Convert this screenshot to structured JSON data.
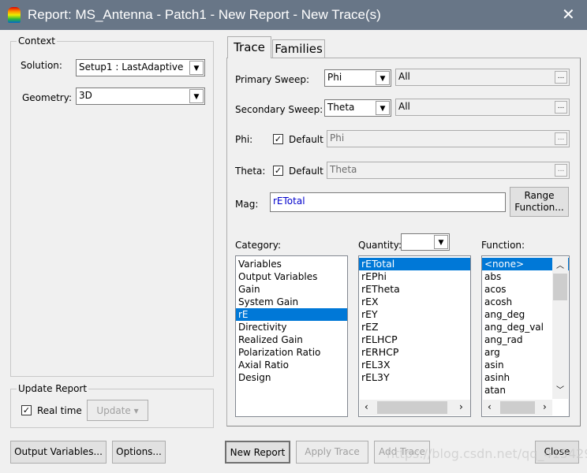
{
  "window": {
    "title": "Report: MS_Antenna - Patch1 - New Report - New Trace(s)",
    "close_glyph": "✕"
  },
  "context": {
    "legend": "Context",
    "solution_label": "Solution:",
    "solution_value": "Setup1 : LastAdaptive",
    "geometry_label": "Geometry:",
    "geometry_value": "3D"
  },
  "update": {
    "legend": "Update Report",
    "realtime_label": "Real time",
    "realtime_checked": true,
    "update_button": "Update"
  },
  "tabs": [
    {
      "label": "Trace",
      "active": true
    },
    {
      "label": "Families",
      "active": false
    }
  ],
  "trace": {
    "primary_label": "Primary Sweep:",
    "primary_value": "Phi",
    "primary_range": "All",
    "secondary_label": "Secondary Sweep:",
    "secondary_value": "Theta",
    "secondary_range": "All",
    "phi_label": "Phi:",
    "phi_default_label": "Default",
    "phi_default_checked": true,
    "phi_value": "Phi",
    "theta_label": "Theta:",
    "theta_default_label": "Default",
    "theta_default_checked": true,
    "theta_value": "Theta",
    "mag_label": "Mag:",
    "mag_value": "rETotal",
    "range_function_button": "Range Function...",
    "category_label": "Category:",
    "quantity_label": "Quantity:",
    "quantity_filter": "",
    "function_label": "Function:",
    "categories": [
      "Variables",
      "Output Variables",
      "Gain",
      "System Gain",
      "rE",
      "Directivity",
      "Realized Gain",
      "Polarization Ratio",
      "Axial Ratio",
      "Design"
    ],
    "selected_category": "rE",
    "quantities": [
      "rETotal",
      "rEPhi",
      "rETheta",
      "rEX",
      "rEY",
      "rEZ",
      "rELHCP",
      "rERHCP",
      "rEL3X",
      "rEL3Y"
    ],
    "selected_quantity": "rETotal",
    "functions": [
      "<none>",
      "abs",
      "acos",
      "acosh",
      "ang_deg",
      "ang_deg_val",
      "ang_rad",
      "arg",
      "asin",
      "asinh",
      "atan"
    ],
    "selected_function": "<none>"
  },
  "buttons": {
    "output_variables": "Output Variables...",
    "options": "Options...",
    "new_report": "New Report",
    "apply_trace": "Apply Trace",
    "add_trace": "Add Trace",
    "close": "Close"
  },
  "watermark": "https://blog.csdn.net/qq_41542947",
  "colors": {
    "titlebar": "#687687",
    "selection": "#0078d7",
    "mag_text": "#0000cc"
  }
}
